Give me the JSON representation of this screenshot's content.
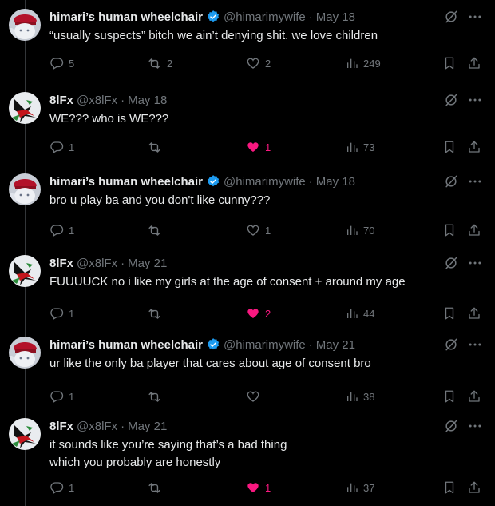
{
  "posts": [
    {
      "author": "himari’s human wheelchair",
      "verified": true,
      "handle": "@himarimywife",
      "time": "May 18",
      "text": "“usually suspects” bitch we ain’t denying shit. we love children",
      "replies": "5",
      "reposts": "2",
      "likes": "2",
      "liked": false,
      "views": "249"
    },
    {
      "author": "8lFx",
      "verified": false,
      "handle": "@x8lFx",
      "time": "May 18",
      "text": "WE??? who is WE???",
      "replies": "1",
      "reposts": "",
      "likes": "1",
      "liked": true,
      "views": "73"
    },
    {
      "author": "himari’s human wheelchair",
      "verified": true,
      "handle": "@himarimywife",
      "time": "May 18",
      "text": "bro u play ba and you don't like cunny???",
      "replies": "1",
      "reposts": "",
      "likes": "1",
      "liked": false,
      "views": "70"
    },
    {
      "author": "8lFx",
      "verified": false,
      "handle": "@x8lFx",
      "time": "May 21",
      "text": "FUUUUCK no i like my girls at the age of consent + around my age",
      "replies": "1",
      "reposts": "",
      "likes": "2",
      "liked": true,
      "views": "44"
    },
    {
      "author": "himari’s human wheelchair",
      "verified": true,
      "handle": "@himarimywife",
      "time": "May 21",
      "text": "ur like the only ba player that cares about age of consent bro",
      "replies": "1",
      "reposts": "",
      "likes": "",
      "liked": false,
      "views": "38"
    },
    {
      "author": "8lFx",
      "verified": false,
      "handle": "@x8lFx",
      "time": "May 21",
      "text": "it sounds like you’re saying that’s a bad thing\nwhich you probably are honestly",
      "replies": "1",
      "reposts": "",
      "likes": "1",
      "liked": true,
      "views": "37"
    }
  ],
  "icons": {
    "grok": "grok-icon",
    "more": "more-icon",
    "reply": "reply-icon",
    "repost": "repost-icon",
    "like": "heart-icon",
    "views": "views-icon",
    "bookmark": "bookmark-icon",
    "share": "share-icon"
  },
  "colors": {
    "background": "#000000",
    "text": "#e7e9ea",
    "muted": "#71767b",
    "like": "#f91880",
    "verified": "#1d9bf0"
  }
}
